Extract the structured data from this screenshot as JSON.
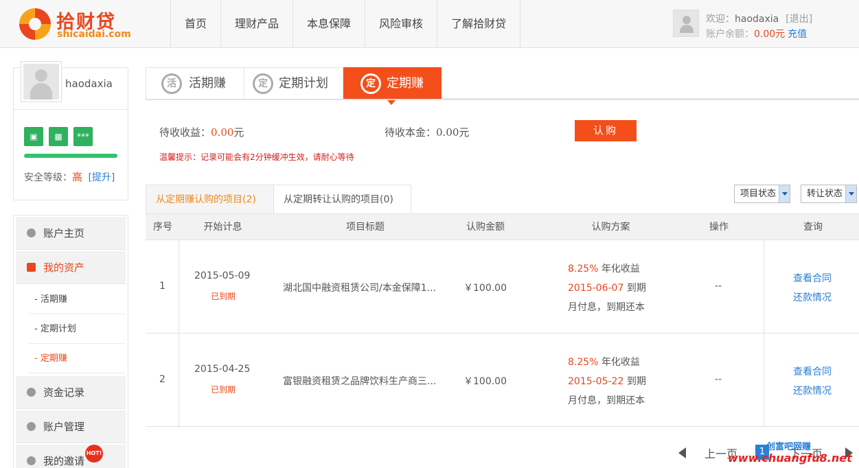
{
  "header": {
    "logo_cn": "拾财贷",
    "logo_en": "shicaidai.com",
    "nav": [
      "首页",
      "理财产品",
      "本息保障",
      "风险审核",
      "了解拾财贷"
    ],
    "welcome_prefix": "欢迎：",
    "username": "haodaxia",
    "logout": "[退出]",
    "balance_label": "账户余额：",
    "balance_value": "0.00元",
    "recharge": "充值"
  },
  "profile": {
    "username": "haodaxia",
    "badges": [
      "id-card-icon",
      "calculator-icon",
      "password-icon"
    ],
    "badge_password_text": "***",
    "security_label": "安全等级：",
    "security_level": "高",
    "security_upgrade": "[提升]",
    "security_color": "#2fc46b"
  },
  "menu": {
    "account_home": "账户主页",
    "my_assets": "我的资产",
    "sub_items": [
      "- 活期赚",
      "- 定期计划",
      "- 定期赚"
    ],
    "fund_records": "资金记录",
    "account_mgmt": "账户管理",
    "my_invite": "我的邀请",
    "hot_badge": "HOT!"
  },
  "tabs": [
    {
      "icon_char": "活",
      "label": "活期赚"
    },
    {
      "icon_char": "定",
      "label": "定期计划"
    },
    {
      "icon_char": "定",
      "label": "定期赚"
    }
  ],
  "summary": {
    "pending_income_label": "待收收益：",
    "pending_income_value": "0.00",
    "pending_income_unit": "元",
    "pending_principal_label": "待收本金：",
    "pending_principal_value": "0.00元",
    "subscribe_button": "认购",
    "tip": "温馨提示：记录可能会有2分钟缓冲生效，请耐心等待"
  },
  "subtabs": [
    "从定期赚认购的项目(2)",
    "从定期转让认购的项目(0)"
  ],
  "filters": {
    "project_status": "项目状态",
    "transfer_status": "转让状态"
  },
  "table": {
    "columns": [
      "序号",
      "开始计息",
      "项目标题",
      "认购金额",
      "认购方案",
      "操作",
      "查询"
    ],
    "rows": [
      {
        "index": "1",
        "start_date": "2015-05-09",
        "status": "已到期",
        "title": "湖北国中融资租赁公司/本金保障1...",
        "amount": "￥100.00",
        "rate": "8.25%",
        "rate_label": "年化收益",
        "due_date": "2015-06-07",
        "due_label": "到期",
        "repay_mode": "月付息，到期还本",
        "operation": "--",
        "view_contract": "查看合同",
        "repayment": "还款情况"
      },
      {
        "index": "2",
        "start_date": "2015-04-25",
        "status": "已到期",
        "title": "富银融资租赁之品牌饮料生产商三...",
        "amount": "￥100.00",
        "rate": "8.25%",
        "rate_label": "年化收益",
        "due_date": "2015-05-22",
        "due_label": "到期",
        "repay_mode": "月付息，到期还本",
        "operation": "--",
        "view_contract": "查看合同",
        "repayment": "还款情况"
      }
    ]
  },
  "pager": {
    "prev": "上一页",
    "current": "1",
    "next": "下一页"
  },
  "watermark": {
    "line1": "创富吧网赚",
    "line2": "www.chuangfu8.net"
  },
  "colors": {
    "accent": "#f44e1b",
    "link": "#2a7fd4",
    "success": "#2fb15e"
  }
}
